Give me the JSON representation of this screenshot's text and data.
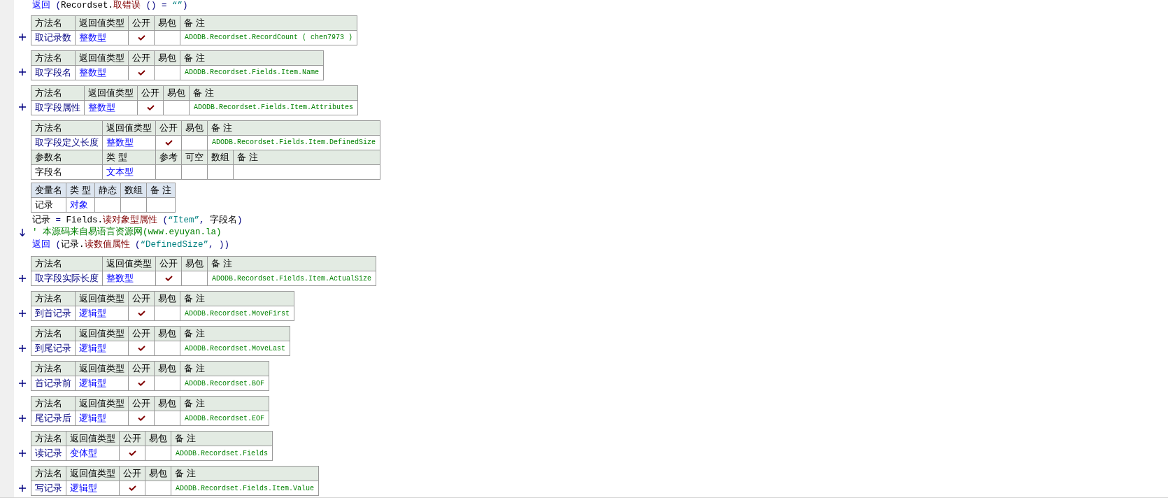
{
  "leading_code": [
    {
      "marker": false,
      "tokens": [
        {
          "kind": "keyword",
          "text": "返回"
        },
        {
          "kind": "punct",
          "text": " ("
        },
        {
          "kind": "plain",
          "text": "Recordset."
        },
        {
          "kind": "method",
          "text": "取错误"
        },
        {
          "kind": "punct",
          "text": " () = "
        },
        {
          "kind": "string",
          "text": "“”"
        },
        {
          "kind": "punct",
          "text": ")"
        }
      ]
    }
  ],
  "methods": [
    {
      "columns": [
        "方法名",
        "返回值类型",
        "公开",
        "易包",
        "备 注"
      ],
      "name": "取记录数",
      "return_type": "整数型",
      "public": true,
      "remark": "ADODB.Recordset.RecordCount ( chen7973 )",
      "expanded": false
    },
    {
      "columns": [
        "方法名",
        "返回值类型",
        "公开",
        "易包",
        "备 注"
      ],
      "name": "取字段名",
      "return_type": "整数型",
      "public": true,
      "remark": "ADODB.Recordset.Fields.Item.Name",
      "expanded": false
    },
    {
      "columns": [
        "方法名",
        "返回值类型",
        "公开",
        "易包",
        "备 注"
      ],
      "name": "取字段属性",
      "return_type": "整数型",
      "public": true,
      "remark": "ADODB.Recordset.Fields.Item.Attributes",
      "expanded": false
    },
    {
      "columns": [
        "方法名",
        "返回值类型",
        "公开",
        "易包",
        "备 注"
      ],
      "name": "取字段定义长度",
      "return_type": "整数型",
      "public": true,
      "remark": "ADODB.Recordset.Fields.Item.DefinedSize",
      "expanded": true,
      "param_columns": [
        "参数名",
        "类 型",
        "参考",
        "可空",
        "数组",
        "备 注"
      ],
      "params": [
        {
          "name": "字段名",
          "type": "文本型"
        }
      ],
      "local_columns": [
        "变量名",
        "类 型",
        "静态",
        "数组",
        "备 注"
      ],
      "locals": [
        {
          "name": "记录",
          "type": "对象"
        }
      ],
      "code": [
        {
          "marker": false,
          "tokens": [
            {
              "kind": "plain",
              "text": "记录"
            },
            {
              "kind": "punct",
              "text": " = "
            },
            {
              "kind": "plain",
              "text": "Fields."
            },
            {
              "kind": "method",
              "text": "读对象型属性"
            },
            {
              "kind": "punct",
              "text": " ("
            },
            {
              "kind": "string",
              "text": "“Item”"
            },
            {
              "kind": "punct",
              "text": ", "
            },
            {
              "kind": "plain",
              "text": "字段名"
            },
            {
              "kind": "punct",
              "text": ")"
            }
          ]
        },
        {
          "marker": true,
          "tokens": [
            {
              "kind": "comment",
              "text": "' 本源码来自易语言资源网(www.eyuyan.la)"
            }
          ]
        },
        {
          "marker": false,
          "tokens": [
            {
              "kind": "keyword",
              "text": "返回"
            },
            {
              "kind": "punct",
              "text": " ("
            },
            {
              "kind": "plain",
              "text": "记录."
            },
            {
              "kind": "method",
              "text": "读数值属性"
            },
            {
              "kind": "punct",
              "text": " ("
            },
            {
              "kind": "string",
              "text": "“DefinedSize”"
            },
            {
              "kind": "punct",
              "text": ", ))"
            }
          ]
        }
      ]
    },
    {
      "columns": [
        "方法名",
        "返回值类型",
        "公开",
        "易包",
        "备 注"
      ],
      "name": "取字段实际长度",
      "return_type": "整数型",
      "public": true,
      "remark": "ADODB.Recordset.Fields.Item.ActualSize",
      "expanded": false
    },
    {
      "columns": [
        "方法名",
        "返回值类型",
        "公开",
        "易包",
        "备 注"
      ],
      "name": "到首记录",
      "return_type": "逻辑型",
      "public": true,
      "remark": "ADODB.Recordset.MoveFirst",
      "expanded": false
    },
    {
      "columns": [
        "方法名",
        "返回值类型",
        "公开",
        "易包",
        "备 注"
      ],
      "name": "到尾记录",
      "return_type": "逻辑型",
      "public": true,
      "remark": "ADODB.Recordset.MoveLast",
      "expanded": false
    },
    {
      "columns": [
        "方法名",
        "返回值类型",
        "公开",
        "易包",
        "备 注"
      ],
      "name": "首记录前",
      "return_type": "逻辑型",
      "public": true,
      "remark": "ADODB.Recordset.BOF",
      "expanded": false
    },
    {
      "columns": [
        "方法名",
        "返回值类型",
        "公开",
        "易包",
        "备 注"
      ],
      "name": "尾记录后",
      "return_type": "逻辑型",
      "public": true,
      "remark": "ADODB.Recordset.EOF",
      "expanded": false
    },
    {
      "columns": [
        "方法名",
        "返回值类型",
        "公开",
        "易包",
        "备 注"
      ],
      "name": "读记录",
      "return_type": "变体型",
      "public": true,
      "remark": "ADODB.Recordset.Fields",
      "expanded": false
    },
    {
      "columns": [
        "方法名",
        "返回值类型",
        "公开",
        "易包",
        "备 注"
      ],
      "name": "写记录",
      "return_type": "逻辑型",
      "public": true,
      "remark": "ADODB.Recordset.Fields.Item.Value",
      "expanded": false
    }
  ]
}
